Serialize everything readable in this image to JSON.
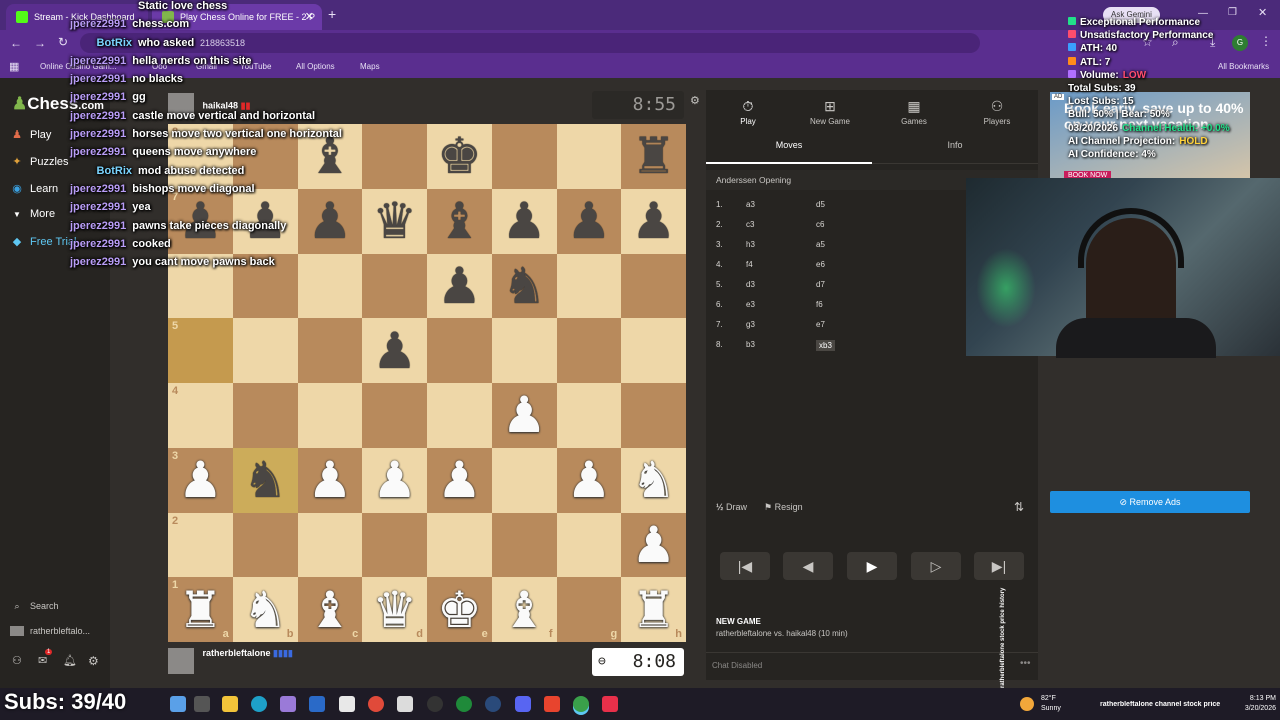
{
  "browser": {
    "tabs": [
      {
        "label": "Stream - Kick Dashboard",
        "favicon_color": "#53fc18"
      },
      {
        "label": "Play Chess Online for FREE - 2 P",
        "favicon_color": "#81b64c"
      }
    ],
    "url_fragment": "218863518",
    "ask_button": "Ask Gemini",
    "bookmarks": [
      "Online Casino Gam...",
      "Ooo",
      "Gmail",
      "YouTube",
      "All Options",
      "Maps"
    ],
    "all_bookmarks": "All Bookmarks"
  },
  "chat": [
    {
      "user": "",
      "text": "Static love chess"
    },
    {
      "user": "jperez2991",
      "text": "chess.com"
    },
    {
      "user": "BotRix",
      "text": "who asked"
    },
    {
      "user": "jperez2991",
      "text": "hella nerds on this site"
    },
    {
      "user": "jperez2991",
      "text": "no blacks"
    },
    {
      "user": "jperez2991",
      "text": "gg"
    },
    {
      "user": "jperez2991",
      "text": "castle move vertical and horizontal"
    },
    {
      "user": "jperez2991",
      "text": "horses move two vertical one horizontal"
    },
    {
      "user": "jperez2991",
      "text": "queens move anywhere"
    },
    {
      "user": "BotRix",
      "text": "mod abuse detected"
    },
    {
      "user": "jperez2991",
      "text": "bishops move diagonal"
    },
    {
      "user": "jperez2991",
      "text": "yea"
    },
    {
      "user": "jperez2991",
      "text": "pawns take pieces diagonally"
    },
    {
      "user": "jperez2991",
      "text": "cooked"
    },
    {
      "user": "jperez2991",
      "text": "you cant move pawns back"
    }
  ],
  "sidenav": {
    "logo": "Chess",
    "logo_suffix": ".com",
    "items": [
      "Play",
      "Puzzles",
      "Learn",
      "More"
    ],
    "free_trial": "Free Trial",
    "search": "Search",
    "username": "ratherbleftalo...",
    "notif_count": "1"
  },
  "board": {
    "opponent": "haikal48",
    "player": "ratherbleftalone",
    "opponent_clock": "8:55",
    "player_clock": "8:08",
    "ranks": [
      "8",
      "7",
      "6",
      "5",
      "4",
      "3",
      "2",
      "1"
    ],
    "files": [
      "a",
      "b",
      "c",
      "d",
      "e",
      "f",
      "g",
      "h"
    ],
    "pieces": [
      [
        "",
        "",
        "bB",
        "",
        "bK",
        "",
        "",
        "bR"
      ],
      [
        "bP",
        "bP",
        "bP",
        "bQ",
        "bB",
        "bP",
        "bP",
        "bP"
      ],
      [
        "",
        "",
        "",
        "",
        "bP",
        "bN",
        "",
        ""
      ],
      [
        "",
        "",
        "",
        "bP",
        "",
        "",
        "",
        ""
      ],
      [
        "",
        "",
        "",
        "",
        "",
        "wP",
        "",
        ""
      ],
      [
        "wP",
        "bN",
        "wP",
        "wP",
        "wP",
        "",
        "wP",
        "wN"
      ],
      [
        "",
        "",
        "",
        "",
        "",
        "",
        "",
        "wP"
      ],
      [
        "wR",
        "wN",
        "wB",
        "wQ",
        "wK",
        "wB",
        "",
        "wR"
      ]
    ],
    "highlights": [
      [
        3,
        0
      ],
      [
        5,
        1
      ]
    ]
  },
  "panel": {
    "tabs": [
      "Play",
      "New Game",
      "Games",
      "Players"
    ],
    "subtabs": [
      "Moves",
      "Info"
    ],
    "opening": "Anderssen Opening",
    "moves": [
      {
        "n": "1.",
        "w": "a3",
        "b": "d5"
      },
      {
        "n": "2.",
        "w": "c3",
        "b": "c6"
      },
      {
        "n": "3.",
        "w": "h3",
        "b": "a5"
      },
      {
        "n": "4.",
        "w": "f4",
        "b": "e6"
      },
      {
        "n": "5.",
        "w": "d3",
        "b": "d7"
      },
      {
        "n": "6.",
        "w": "e3",
        "b": "f6"
      },
      {
        "n": "7.",
        "w": "g3",
        "b": "e7"
      },
      {
        "n": "8.",
        "w": "b3",
        "b": "xb3"
      }
    ],
    "draw": "Draw",
    "resign": "Resign",
    "new_game_title": "NEW GAME",
    "new_game_desc": "ratherbleftalone vs. haikal48 (10 min)",
    "chat_disabled": "Chat Disabled"
  },
  "stream_stats": [
    {
      "label": "Exceptional Performance",
      "color": "#22e08a"
    },
    {
      "label": "Unsatisfactory Performance",
      "color": "#ff4d6d"
    },
    {
      "label": "ATH: 40",
      "color": "#3aa0ff"
    },
    {
      "label": "ATL: 7",
      "color": "#ff8c1a"
    },
    {
      "label": "Volume:",
      "value": "LOW",
      "color": "#b070ff"
    },
    {
      "label": "Total Subs: 39",
      "color": ""
    },
    {
      "label": "Lost Subs: 15",
      "color": ""
    },
    {
      "label": "Bull: 50% | Bear: 50%",
      "color": ""
    },
    {
      "label": "03/20/2026",
      "value": "Channel Health: +0.0%",
      "color": ""
    },
    {
      "label": "AI Channel Projection:",
      "value": "HOLD",
      "color": ""
    },
    {
      "label": "AI Confidence: 4%",
      "color": ""
    }
  ],
  "ad": {
    "text": "Book early, save up to 40% on your next vacation",
    "button": "BOOK NOW",
    "remove": "Remove Ads"
  },
  "vertical_caption": "ratherbleftalone stock price history",
  "taskbar": {
    "subs": "Subs: 39/40",
    "weather_temp": "82°F",
    "weather_desc": "Sunny",
    "ticker": "ratherbleftalone channel stock price",
    "time": "8:13 PM",
    "date": "3/20/2026"
  }
}
